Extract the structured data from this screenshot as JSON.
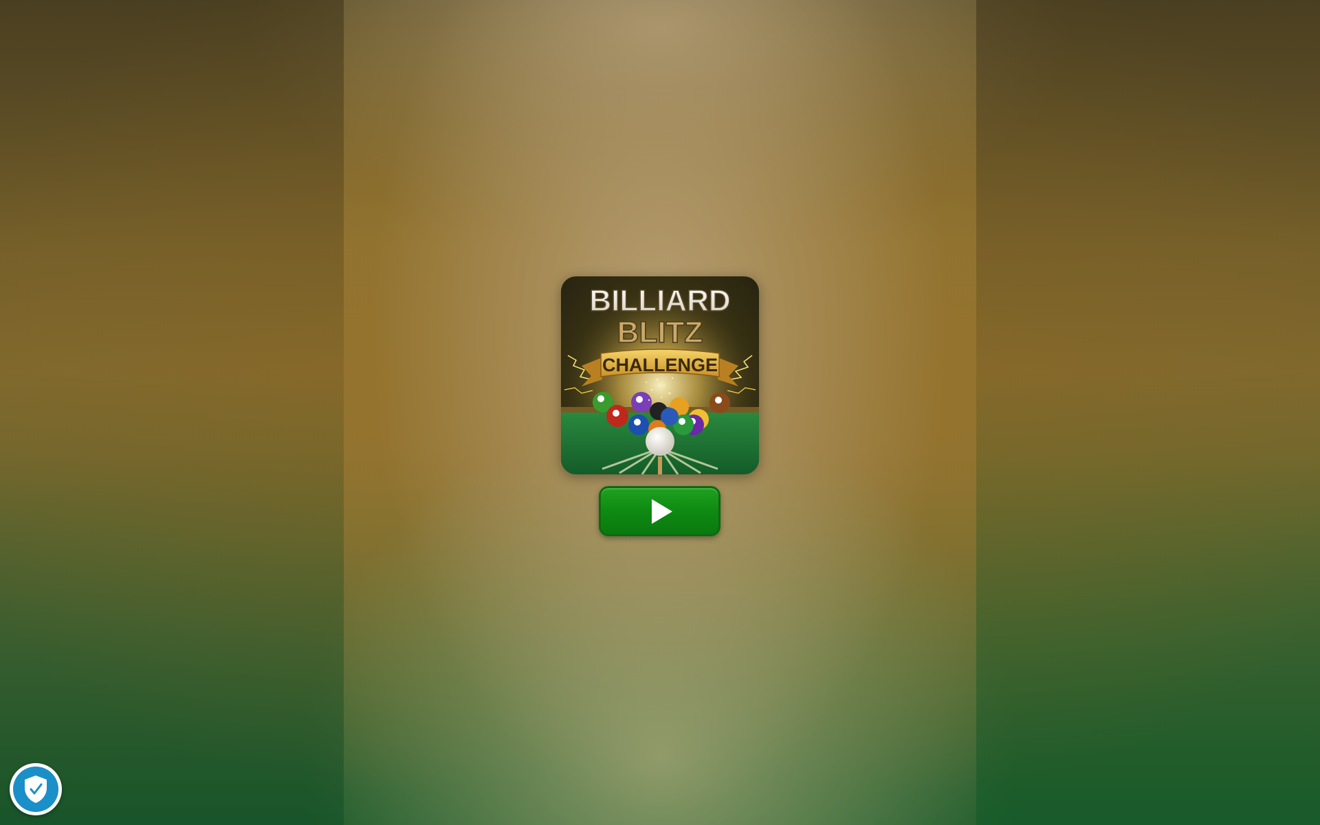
{
  "game": {
    "title_line1": "BILLIARD",
    "title_line2": "BLITZ",
    "title_banner": "CHALLENGE"
  },
  "play_button": {
    "icon": "play-icon"
  },
  "privacy_badge": {
    "icon": "shield-check-icon",
    "color": "#1a8fc8"
  },
  "colors": {
    "play_green": "#0e8a12",
    "felt_green": "#1e7a35",
    "banner_gold": "#e3b43a"
  }
}
